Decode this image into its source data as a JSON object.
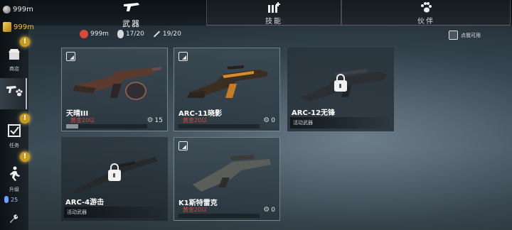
{
  "currency": {
    "silver": "999m",
    "gold": "999m"
  },
  "tabs": {
    "weapons": "武器",
    "skills": "技能",
    "partners": "伙伴"
  },
  "sidebar": {
    "items": [
      {
        "label": "商店"
      },
      {
        "label": "装备"
      },
      {
        "label": "任务"
      },
      {
        "label": "升级"
      }
    ],
    "energy": "25"
  },
  "stats": {
    "ammo": "999m",
    "grenades": "17/20",
    "knives": "19/20"
  },
  "hint": {
    "label": "点我可用"
  },
  "weapons": [
    {
      "name": "天晴III",
      "price": "黄金20以",
      "parts": "15",
      "progress": 0.15,
      "locked": false
    },
    {
      "name": "ARC-11晓影",
      "price": "黄金20以",
      "parts": "0",
      "progress": 0,
      "locked": false
    },
    {
      "name": "ARC-12无锋",
      "event": "活动武器",
      "locked": true
    },
    {
      "name": "ARC-4游击",
      "event": "活动武器",
      "locked": true
    },
    {
      "name": "K1斯特雷克",
      "price": "黄金20以",
      "parts": "0",
      "progress": 0,
      "locked": false
    }
  ],
  "colors": {
    "price_red": "#d9473b",
    "gold": "#f1c232",
    "alert": "#c79a1d"
  }
}
